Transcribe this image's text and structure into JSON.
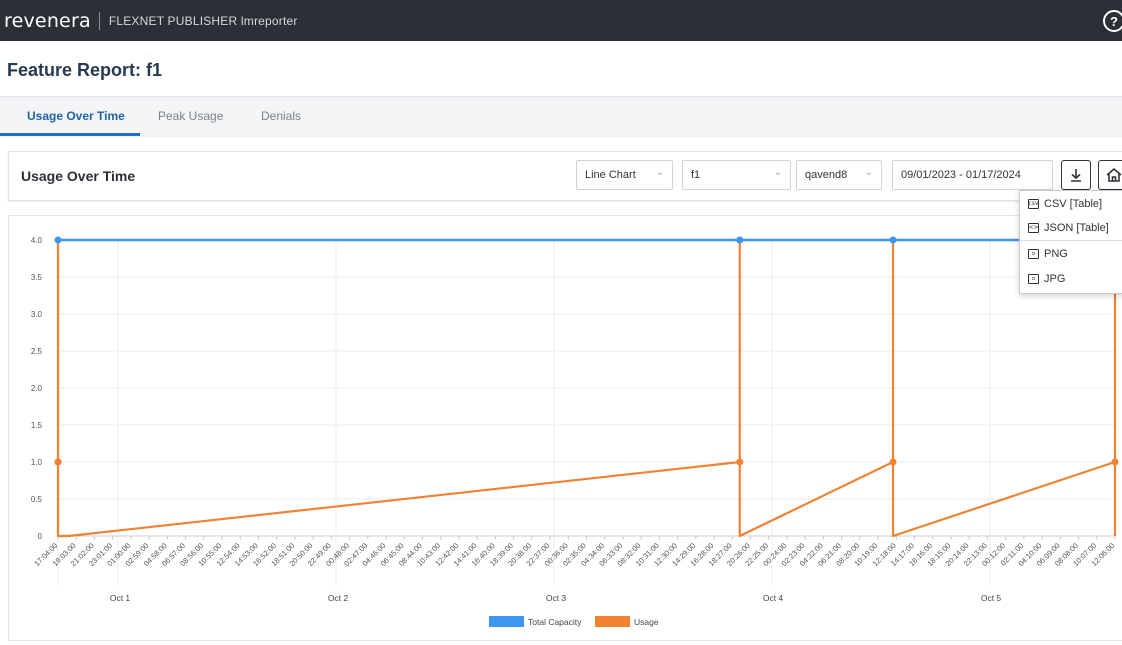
{
  "header": {
    "brand": "revenera",
    "app_name": "FLEXNET PUBLISHER lmreporter",
    "help_symbol": "?"
  },
  "page": {
    "title": "Feature Report: f1"
  },
  "tabs": [
    {
      "label": "Usage Over Time",
      "active": true
    },
    {
      "label": "Peak Usage",
      "active": false
    },
    {
      "label": "Denials",
      "active": false
    }
  ],
  "panel": {
    "title": "Usage Over Time",
    "chart_type_select": "Line Chart",
    "feature_select": "f1",
    "vendor_select": "qavend8",
    "date_range": "09/01/2023 - 01/17/2024",
    "download_icon": "download-icon",
    "home_icon": "home-icon"
  },
  "download_menu": {
    "items": [
      {
        "label": "CSV [Table]",
        "icon": "csv-icon",
        "icon_text": "csv"
      },
      {
        "label": "JSON [Table]",
        "icon": "json-icon",
        "icon_text": "<>"
      },
      {
        "label": "PNG",
        "icon": "image-icon",
        "icon_text": "▫"
      },
      {
        "label": "JPG",
        "icon": "image-icon",
        "icon_text": "▫"
      }
    ]
  },
  "colors": {
    "capacity": "#3d97ee",
    "usage": "#f08232",
    "accent": "#1e6fce",
    "topbar": "#2b2f36"
  },
  "chart_data": {
    "type": "line",
    "ylim": [
      0,
      4.0
    ],
    "y_ticks": [
      "0",
      "0.5",
      "1.0",
      "1.5",
      "2.0",
      "2.5",
      "3.0",
      "3.5",
      "4.0"
    ],
    "x_ticks": [
      "17:04:00",
      "19:03:00",
      "21:02:00",
      "23:01:00",
      "01:00:00",
      "02:59:00",
      "04:58:00",
      "06:57:00",
      "08:56:00",
      "10:55:00",
      "12:54:00",
      "14:53:00",
      "16:52:00",
      "18:51:00",
      "20:50:00",
      "22:49:00",
      "00:48:00",
      "02:47:00",
      "04:46:00",
      "06:45:00",
      "08:44:00",
      "10:43:00",
      "12:42:00",
      "14:41:00",
      "16:40:00",
      "18:39:00",
      "20:38:00",
      "22:37:00",
      "00:36:00",
      "02:35:00",
      "04:34:00",
      "06:33:00",
      "08:32:00",
      "10:31:00",
      "12:30:00",
      "14:29:00",
      "16:28:00",
      "18:27:00",
      "20:26:00",
      "22:25:00",
      "00:24:00",
      "02:23:00",
      "04:22:00",
      "06:21:00",
      "08:20:00",
      "10:19:00",
      "12:18:00",
      "14:17:00",
      "16:16:00",
      "18:15:00",
      "20:14:00",
      "22:13:00",
      "00:12:00",
      "02:11:00",
      "04:10:00",
      "06:09:00",
      "08:08:00",
      "10:07:00",
      "12:06:00"
    ],
    "day_labels": [
      "Oct 1",
      "Oct 2",
      "Oct 3",
      "Oct 4",
      "Oct 5"
    ],
    "grid": true,
    "legend_placement": "bottom-center",
    "series": [
      {
        "name": "Total Capacity",
        "points": [
          [
            0,
            4
          ],
          [
            129,
            4
          ],
          [
            158,
            4
          ],
          [
            200,
            4
          ]
        ]
      },
      {
        "name": "Usage",
        "points": [
          [
            0,
            0
          ],
          [
            0,
            1
          ],
          [
            0,
            4
          ],
          [
            0,
            1
          ],
          [
            0,
            0
          ],
          [
            2,
            0
          ],
          [
            129,
            1
          ],
          [
            129,
            4
          ],
          [
            129,
            0
          ],
          [
            158,
            1
          ],
          [
            158,
            4
          ],
          [
            158,
            0
          ],
          [
            200,
            1
          ],
          [
            200,
            4
          ],
          [
            200,
            0
          ]
        ]
      }
    ]
  }
}
